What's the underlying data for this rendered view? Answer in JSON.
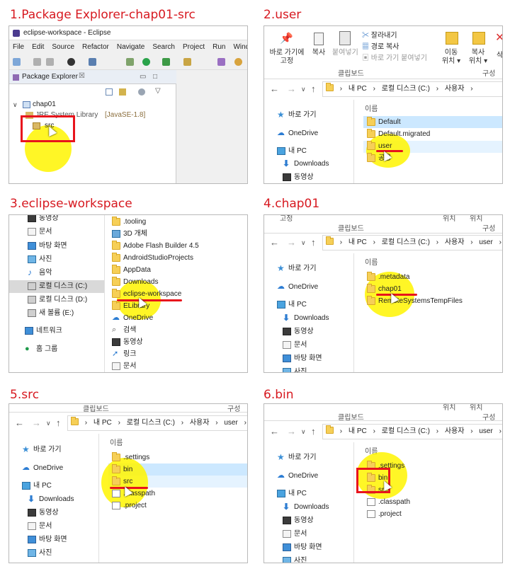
{
  "steps": [
    "1.Package Explorer-chap01-src",
    "2.user",
    "3.eclipse-workspace",
    "4.chap01",
    "5.src",
    "6.bin"
  ],
  "eclipse": {
    "title": "eclipse-workspace - Eclipse",
    "menu": [
      "File",
      "Edit",
      "Source",
      "Refactor",
      "Navigate",
      "Search",
      "Project",
      "Run",
      "Window"
    ],
    "view_title": "Package Explorer",
    "view_close": "☒",
    "tree": {
      "project": "chap01",
      "library": "JRE System Library",
      "library_version": "[JavaSE-1.8]",
      "folder": "src"
    }
  },
  "explorer": {
    "ribbon": {
      "pin": "바로 가기에",
      "pin2": "고정",
      "copy": "복사",
      "paste": "붙여넣기",
      "cut": "잘라내기",
      "copy_path": "경로 복사",
      "paste_shortcut": "바로 가기 붙여넣기",
      "move": "이동",
      "move2": "위치",
      "copyto": "복사",
      "copyto2": "위치",
      "clipboard": "클립보드",
      "organize": "구성",
      "delete": "삭",
      "top_left": "고정",
      "top_right1": "위치",
      "top_right2": "위치"
    },
    "address": {
      "pc": "내 PC",
      "disk": "로컬 디스크 (C:)",
      "users": "사용자",
      "user": "user",
      "trunc": "e"
    },
    "header": "이름",
    "nav": {
      "quick": "바로 가기",
      "onedrive": "OneDrive",
      "mypc": "내 PC",
      "downloads": "Downloads",
      "videos": "동영상",
      "docs": "문서",
      "desktop": "바탕 화면",
      "pics": "사진",
      "music": "음악",
      "local": "로컬 디스크 (C:)",
      "local_d": "로컬 디스크 (D:)",
      "new_vol": "새 볼륨 (E:)",
      "network": "네트워크",
      "homegroup": "홈 그룹"
    },
    "p2_files": [
      "Default",
      "Default.migrated",
      "user",
      "공용"
    ],
    "p3_files": [
      ".tooling",
      "3D 개체",
      "Adobe Flash Builder 4.5",
      "AndroidStudioProjects",
      "AppData",
      "Downloads",
      "eclipse-workspace",
      "ELibrary",
      "OneDrive",
      "검색",
      "동영상",
      "링크",
      "문서"
    ],
    "p4_files": [
      ".metadata",
      "chap01",
      "RemoteSystemsTempFiles"
    ],
    "p5_files": [
      ".settings",
      "bin",
      "src",
      ".classpath",
      ".project"
    ],
    "p6_files": [
      ".settings",
      "bin",
      "src",
      ".classpath",
      ".project"
    ]
  }
}
